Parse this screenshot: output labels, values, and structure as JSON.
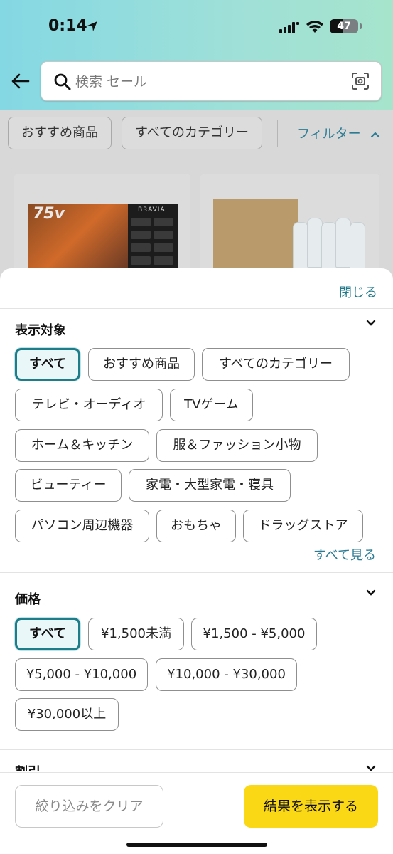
{
  "status_bar": {
    "time": "0:14",
    "battery": "47",
    "battery_level": 0.47
  },
  "search": {
    "placeholder": "検索 セール"
  },
  "top_chips": [
    "おすすめ商品",
    "すべてのカテゴリー"
  ],
  "filter_link": "フィルター",
  "products": [
    {
      "badge": "75v",
      "brand": "BRAVIA"
    },
    {
      "badge": ""
    }
  ],
  "sheet": {
    "close_label": "閉じる",
    "display_section": {
      "title": "表示対象",
      "chips": [
        "すべて",
        "おすすめ商品",
        "すべてのカテゴリー",
        "テレビ・オーディオ",
        "TVゲーム",
        "ホーム＆キッチン",
        "服＆ファッション小物",
        "ビューティー",
        "家電・大型家電・寝具",
        "パソコン周辺機器",
        "おもちゃ",
        "ドラッグストア"
      ],
      "selected": "すべて",
      "see_all": "すべて見る"
    },
    "price_section": {
      "title": "価格",
      "chips": [
        "すべて",
        "¥1,500未満",
        "¥1,500 - ¥5,000",
        "¥5,000 - ¥10,000",
        "¥10,000 - ¥30,000",
        "¥30,000以上"
      ],
      "selected": "すべて"
    },
    "next_section_title": "割引"
  },
  "footer": {
    "clear_label": "絞り込みをクリア",
    "show_label": "結果を表示する"
  },
  "colors": {
    "accent": "#1d7e89",
    "link": "#2a7b93",
    "cta": "#fbd816"
  }
}
